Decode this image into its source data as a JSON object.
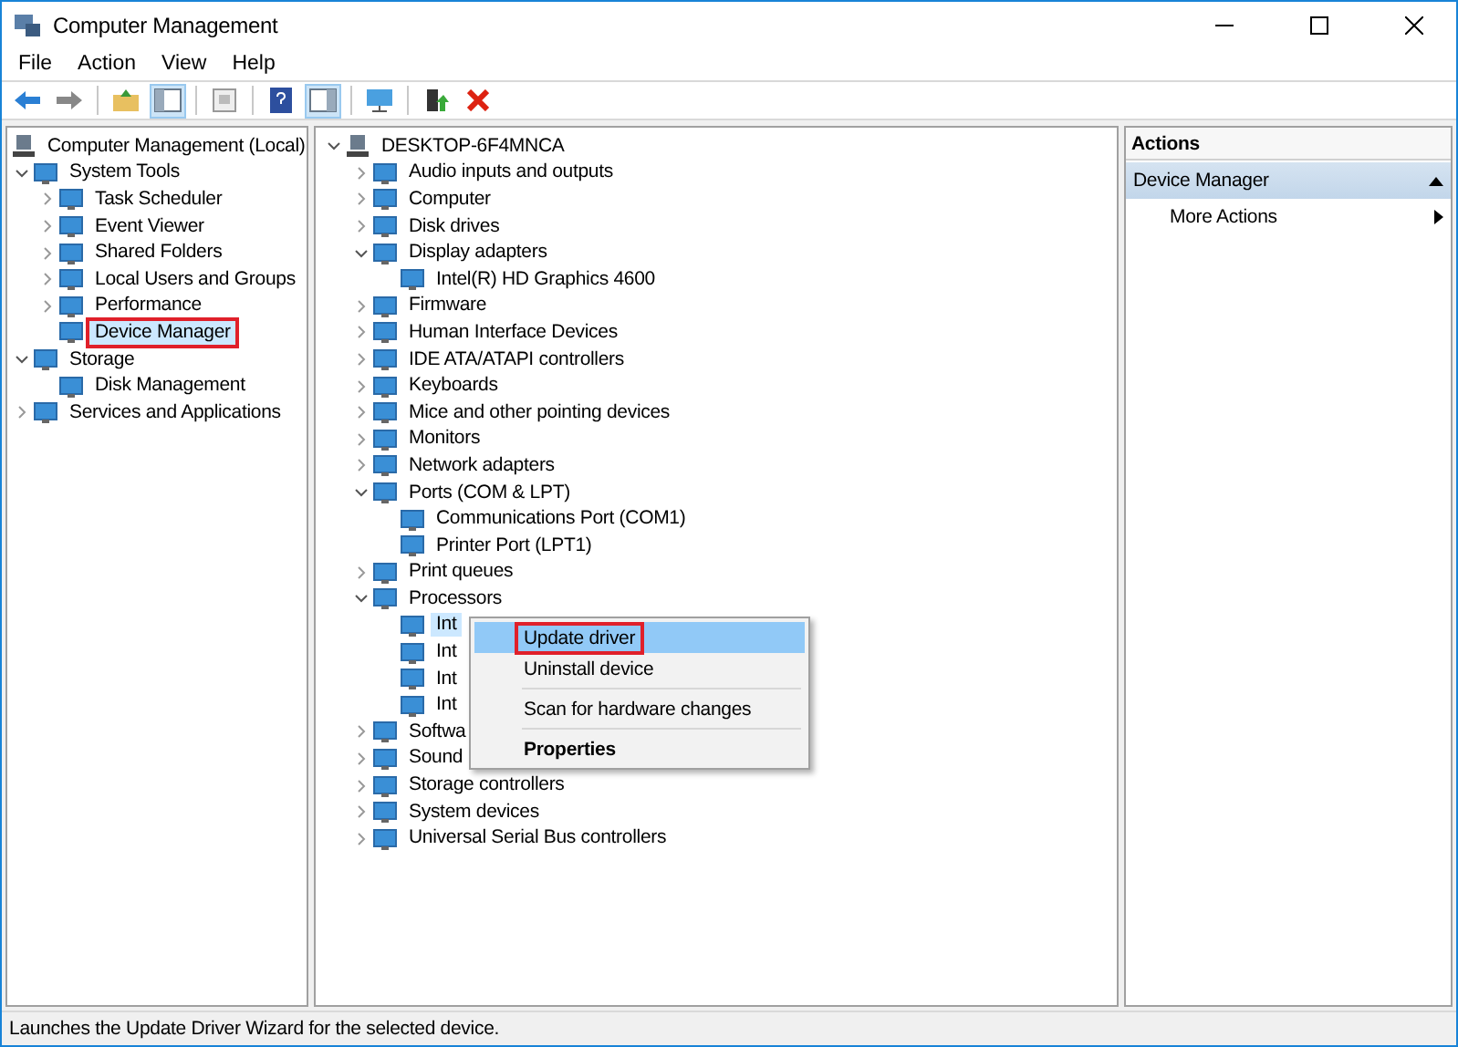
{
  "window": {
    "title": "Computer Management"
  },
  "menu": [
    "File",
    "Action",
    "View",
    "Help"
  ],
  "left_tree": [
    {
      "label": "Computer Management (Local)",
      "selected": false,
      "highlighted": false,
      "children": [
        {
          "label": "System Tools",
          "expanded": true,
          "selected": false,
          "highlighted": false,
          "children": [
            {
              "label": "Task Scheduler",
              "expanded": false,
              "selected": false,
              "highlighted": false
            },
            {
              "label": "Event Viewer",
              "expanded": false,
              "selected": false,
              "highlighted": false
            },
            {
              "label": "Shared Folders",
              "expanded": false,
              "selected": false,
              "highlighted": false
            },
            {
              "label": "Local Users and Groups",
              "expanded": false,
              "selected": false,
              "highlighted": false
            },
            {
              "label": "Performance",
              "expanded": false,
              "selected": false,
              "highlighted": false
            },
            {
              "label": "Device Manager",
              "selected": true,
              "highlighted": true
            }
          ]
        },
        {
          "label": "Storage",
          "expanded": true,
          "selected": false,
          "highlighted": false,
          "children": [
            {
              "label": "Disk Management",
              "selected": false,
              "highlighted": false
            }
          ]
        },
        {
          "label": "Services and Applications",
          "expanded": false,
          "selected": false,
          "highlighted": false
        }
      ]
    }
  ],
  "device_tree": [
    {
      "label": "DESKTOP-6F4MNCA",
      "expanded": true,
      "selected": false,
      "children": [
        {
          "label": "Audio inputs and outputs",
          "expanded": false,
          "selected": false
        },
        {
          "label": "Computer",
          "expanded": false,
          "selected": false
        },
        {
          "label": "Disk drives",
          "expanded": false,
          "selected": false
        },
        {
          "label": "Display adapters",
          "expanded": true,
          "selected": false,
          "children": [
            {
              "label": "Intel(R) HD Graphics 4600",
              "selected": false
            }
          ]
        },
        {
          "label": "Firmware",
          "expanded": false,
          "selected": false
        },
        {
          "label": "Human Interface Devices",
          "expanded": false,
          "selected": false
        },
        {
          "label": "IDE ATA/ATAPI controllers",
          "expanded": false,
          "selected": false
        },
        {
          "label": "Keyboards",
          "expanded": false,
          "selected": false
        },
        {
          "label": "Mice and other pointing devices",
          "expanded": false,
          "selected": false
        },
        {
          "label": "Monitors",
          "expanded": false,
          "selected": false
        },
        {
          "label": "Network adapters",
          "expanded": false,
          "selected": false
        },
        {
          "label": "Ports (COM & LPT)",
          "expanded": true,
          "selected": false,
          "children": [
            {
              "label": "Communications Port (COM1)",
              "selected": false
            },
            {
              "label": "Printer Port (LPT1)",
              "selected": false
            }
          ]
        },
        {
          "label": "Print queues",
          "expanded": false,
          "selected": false
        },
        {
          "label": "Processors",
          "expanded": true,
          "selected": false,
          "children": [
            {
              "label": "Int",
              "selected": true
            },
            {
              "label": "Int",
              "selected": false
            },
            {
              "label": "Int",
              "selected": false
            },
            {
              "label": "Int",
              "selected": false
            }
          ]
        },
        {
          "label": "Softwa",
          "expanded": false,
          "selected": false
        },
        {
          "label": "Sound",
          "expanded": false,
          "selected": false
        },
        {
          "label": "Storage controllers",
          "expanded": false,
          "selected": false
        },
        {
          "label": "System devices",
          "expanded": false,
          "selected": false
        },
        {
          "label": "Universal Serial Bus controllers",
          "expanded": false,
          "selected": false
        }
      ]
    }
  ],
  "context_menu": [
    {
      "kind": "item",
      "label": "Update driver",
      "selected": true,
      "highlighted": true,
      "default": false
    },
    {
      "kind": "item",
      "label": "Uninstall device",
      "selected": false,
      "highlighted": false,
      "default": false
    },
    {
      "kind": "separator"
    },
    {
      "kind": "item",
      "label": "Scan for hardware changes",
      "selected": false,
      "highlighted": false,
      "default": false
    },
    {
      "kind": "separator"
    },
    {
      "kind": "item",
      "label": "Properties",
      "selected": false,
      "highlighted": false,
      "default": true
    }
  ],
  "actions": {
    "header": "Actions",
    "section": "Device Manager",
    "items": [
      "More Actions"
    ]
  },
  "status_bar": "Launches the Update Driver Wizard for the selected device."
}
